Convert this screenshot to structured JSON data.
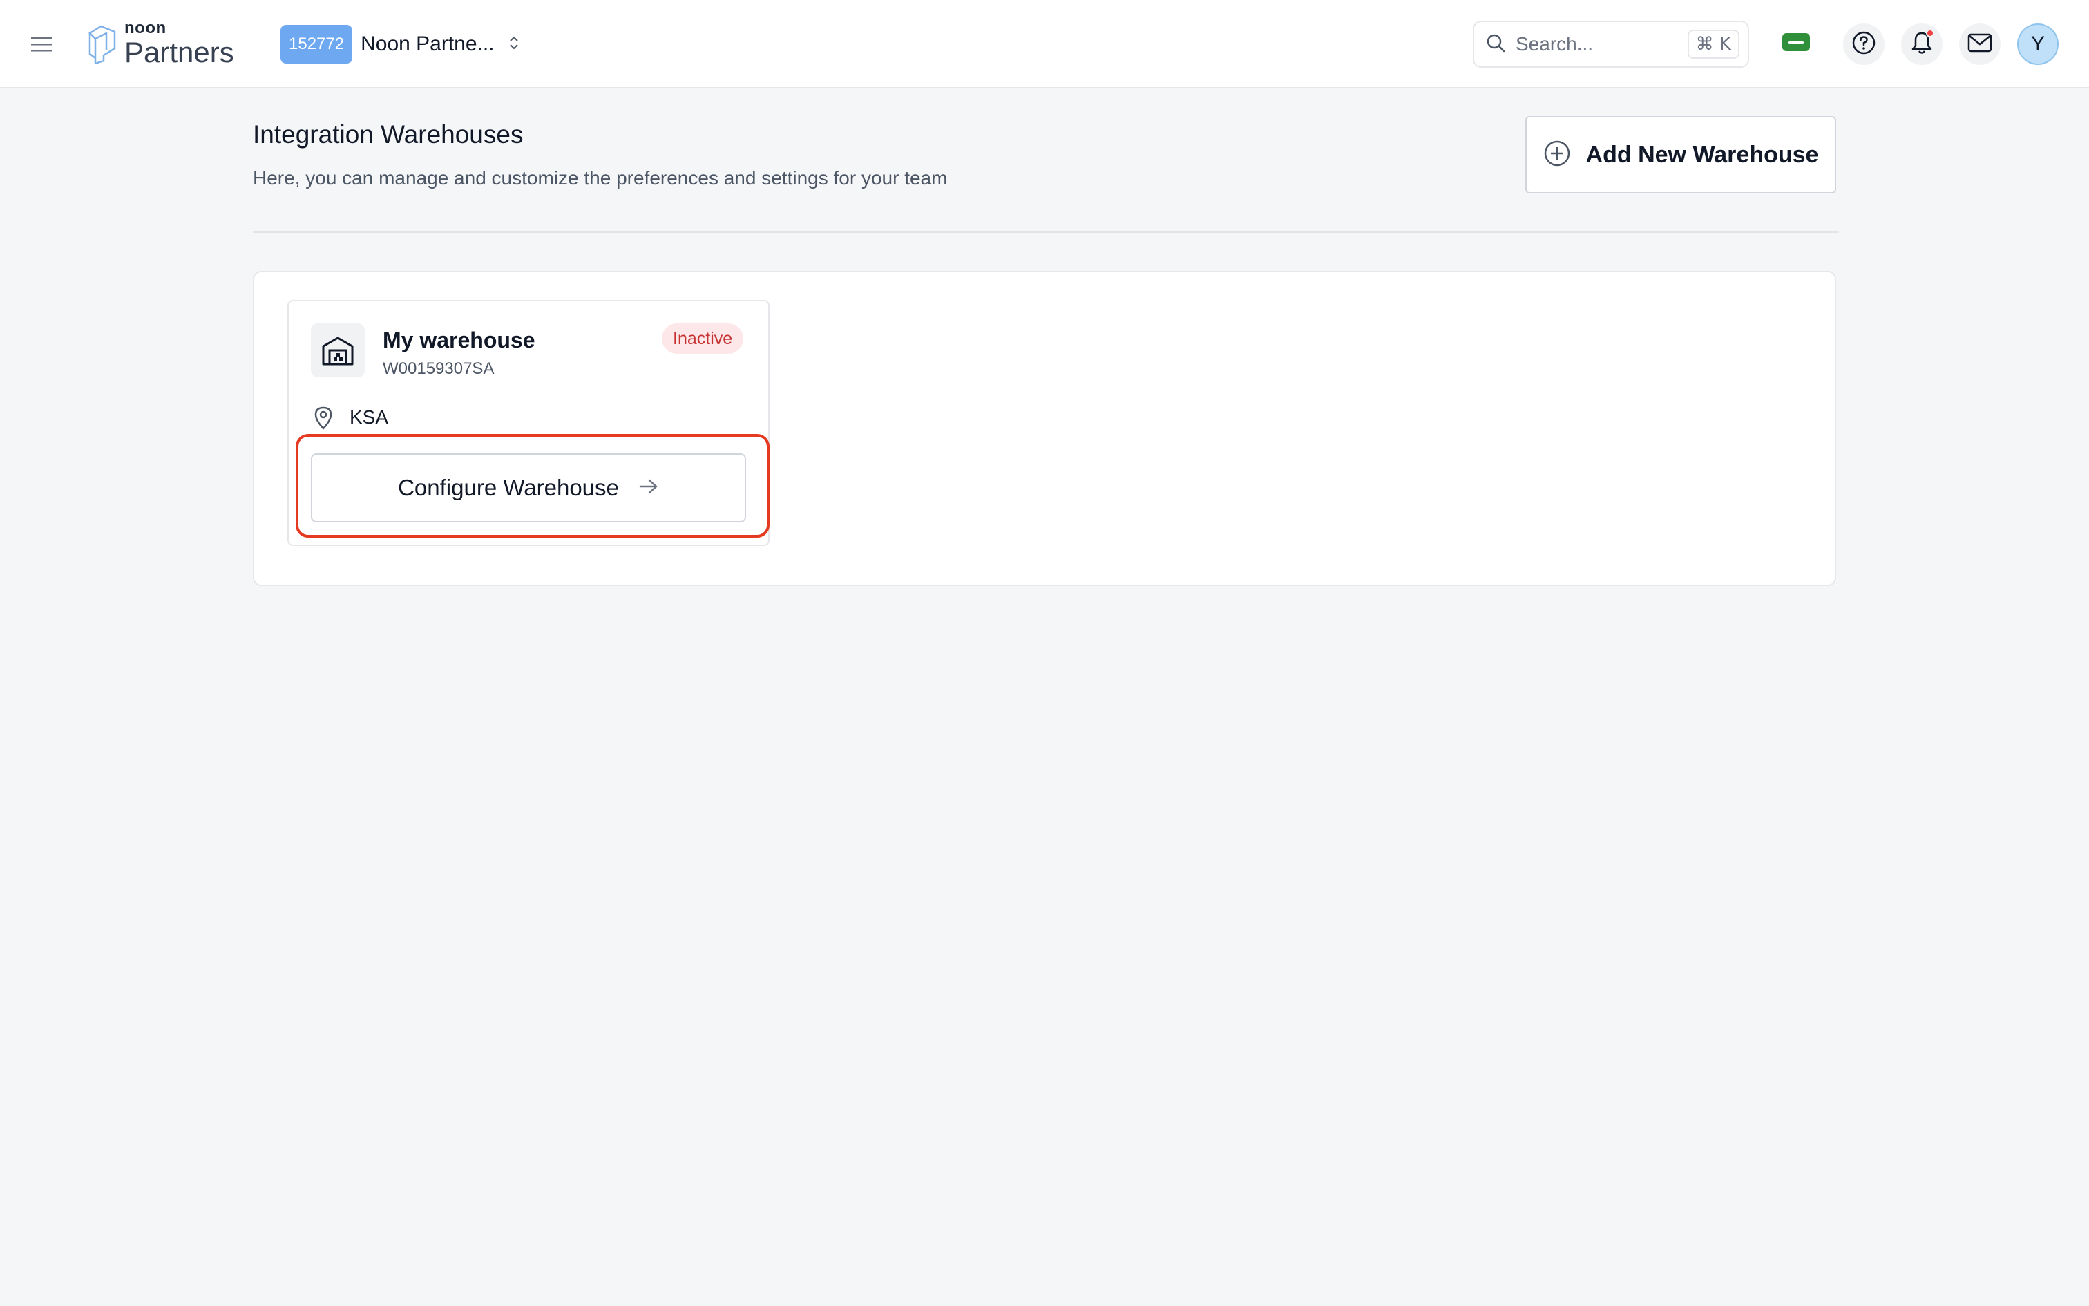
{
  "header": {
    "logo_small": "noon",
    "logo_big": "Partners",
    "account_id": "152772",
    "account_name": "Noon Partne...",
    "search": {
      "placeholder": "Search...",
      "shortcut": "⌘ K"
    },
    "flag_color": "#2f8f3a",
    "avatar_initial": "Y",
    "notification_dot_color": "#ef4444"
  },
  "page": {
    "title": "Integration Warehouses",
    "subtitle": "Here, you can manage and customize the preferences and settings for your team",
    "add_button_label": "Add New Warehouse"
  },
  "warehouses": [
    {
      "name": "My warehouse",
      "code": "W00159307SA",
      "status": "Inactive",
      "status_color": "#c53030",
      "location": "KSA",
      "action_label": "Configure Warehouse"
    }
  ],
  "icons": {
    "menu": "hamburger-icon",
    "search": "search-icon",
    "help": "help-circle-icon",
    "notifications": "bell-icon",
    "messages": "mail-icon",
    "add": "plus-circle-icon",
    "warehouse": "warehouse-icon",
    "location": "map-pin-icon",
    "arrow": "arrow-right-icon"
  },
  "colors": {
    "accent": "#6ea8f0",
    "highlight": "#e53a21"
  }
}
